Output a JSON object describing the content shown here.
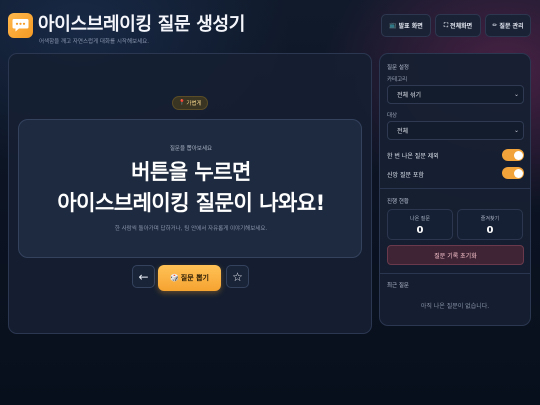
{
  "header": {
    "title": "아이스브레이킹 질문 생성기",
    "subtitle": "어색함을 깨고 자연스럽게 대화를 시작해보세요.",
    "buttons": {
      "presentation": {
        "icon": "📺",
        "label": "발표 화면"
      },
      "fullscreen": {
        "icon": "⛶",
        "label": "전체화면"
      },
      "manage": {
        "icon": "✏",
        "label": "질문 관리"
      }
    }
  },
  "main": {
    "category_badge": {
      "icon": "📍",
      "label": "가볍게"
    },
    "card": {
      "kicker": "질문을 뽑아보세요",
      "line1": "버튼을 누르면",
      "line2": "아이스브레이킹 질문이 나와요!",
      "hint": "한 사람씩 돌아가며 답하거나, 팀 안에서 자유롭게 이야기해보세요."
    },
    "prev_icon": "←",
    "draw_button": {
      "icon": "🎲",
      "label": "질문 뽑기"
    },
    "favorite_icon": "☆"
  },
  "sidebar": {
    "settings_title": "질문 설정",
    "category_label": "카테고리",
    "category_value": "전체 섞기",
    "target_label": "대상",
    "target_value": "전체",
    "toggles": [
      {
        "label": "한 번 나온 질문 제외",
        "on": true
      },
      {
        "label": "신앙 질문 포함",
        "on": true
      }
    ],
    "progress_title": "진행 현황",
    "stats": [
      {
        "label": "나온 질문",
        "value": "0"
      },
      {
        "label": "즐겨찾기",
        "value": "0"
      }
    ],
    "reset_label": "질문 기록 초기화",
    "recent_title": "최근 질문",
    "recent_empty": "아직 나온 질문이 없습니다."
  },
  "colors": {
    "accent": "#f6a331",
    "toggle_on": "#f2a33a",
    "reset_bg": "#3e2434"
  }
}
